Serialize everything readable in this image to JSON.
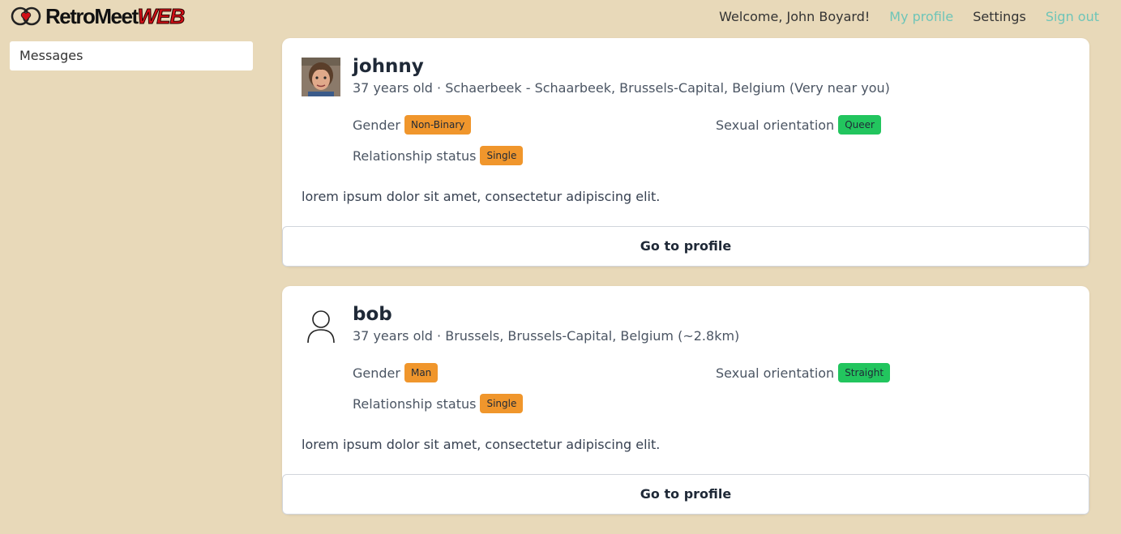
{
  "header": {
    "logo_text": "RetroMeet",
    "logo_accent": "WEB",
    "welcome": "Welcome, John Boyard!",
    "nav": {
      "my_profile": "My profile",
      "settings": "Settings",
      "sign_out": "Sign out"
    },
    "accent_color": "#6ec5b8"
  },
  "sidebar": {
    "items": [
      {
        "label": "Messages"
      }
    ]
  },
  "profiles": [
    {
      "username": "johnny",
      "subline": "37 years old · Schaerbeek - Schaarbeek, Brussels-Capital, Belgium (Very near you)",
      "avatar": "photo",
      "gender_label": "Gender",
      "gender": "Non-Binary",
      "orientation_label": "Sexual orientation",
      "orientation": "Queer",
      "status_label": "Relationship status",
      "status": "Single",
      "bio": "lorem ipsum dolor sit amet, consectetur adipiscing elit.",
      "button": "Go to profile"
    },
    {
      "username": "bob",
      "subline": "37 years old · Brussels, Brussels-Capital, Belgium (~2.8km)",
      "avatar": "user-placeholder-icon",
      "gender_label": "Gender",
      "gender": "Man",
      "orientation_label": "Sexual orientation",
      "orientation": "Straight",
      "status_label": "Relationship status",
      "status": "Single",
      "bio": "lorem ipsum dolor sit amet, consectetur adipiscing elit.",
      "button": "Go to profile"
    }
  ],
  "colors": {
    "background": "#e8d9b9",
    "badge_orange": "#f0962c",
    "badge_green": "#22c55e",
    "logo_red": "#d10f16"
  }
}
